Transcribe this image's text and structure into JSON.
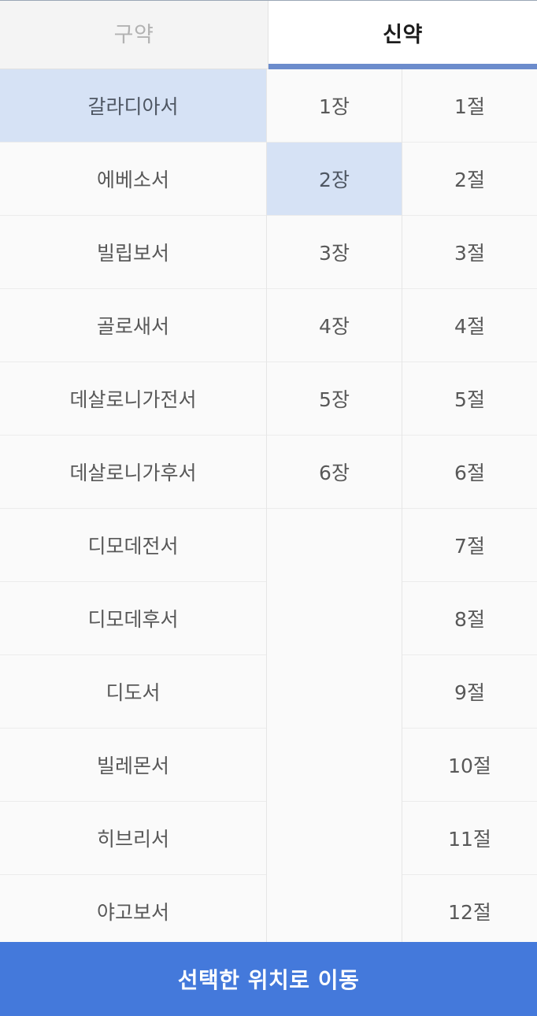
{
  "tabs": [
    {
      "id": "old-testament",
      "label": "구약",
      "active": false
    },
    {
      "id": "new-testament",
      "label": "신약",
      "active": true
    }
  ],
  "colors": {
    "accent": "#4479db",
    "tab_underline": "#6c8ccc",
    "selection": "#d6e2f5",
    "cell_background": "#fafafa",
    "cell_text": "#585858",
    "inactive_tab_text": "#b2b2b2",
    "active_tab_text": "#1c1c1c",
    "divider": "#ececec",
    "button_text": "#ffffff"
  },
  "columns": {
    "books": {
      "name": "book-column",
      "selected_index": 0,
      "items": [
        "갈라디아서",
        "에베소서",
        "빌립보서",
        "골로새서",
        "데살로니가전서",
        "데살로니가후서",
        "디모데전서",
        "디모데후서",
        "디도서",
        "빌레몬서",
        "히브리서",
        "야고보서"
      ]
    },
    "chapters": {
      "name": "chapter-column",
      "selected_index": 1,
      "items": [
        "1장",
        "2장",
        "3장",
        "4장",
        "5장",
        "6장"
      ]
    },
    "verses": {
      "name": "verse-column",
      "selected_index": null,
      "items": [
        "1절",
        "2절",
        "3절",
        "4절",
        "5절",
        "6절",
        "7절",
        "8절",
        "9절",
        "10절",
        "11절",
        "12절"
      ]
    }
  },
  "action_button": {
    "label": "선택한 위치로 이동"
  }
}
